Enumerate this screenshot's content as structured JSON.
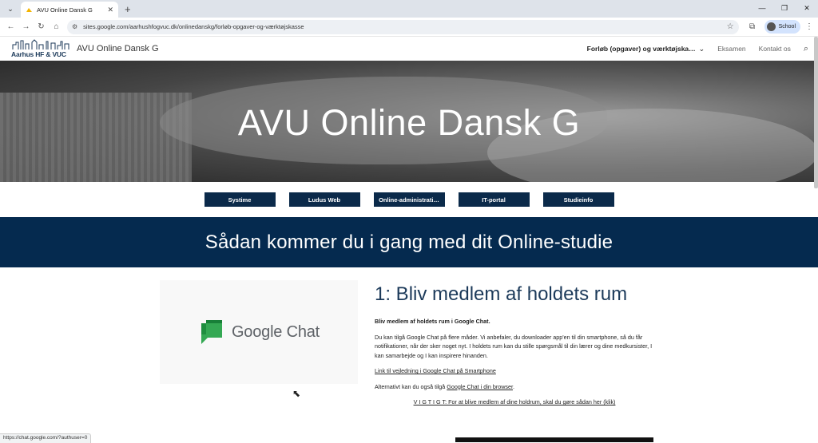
{
  "browser": {
    "tab_title": "AVU Online Dansk G",
    "tab_close": "✕",
    "new_tab": "+",
    "url": "sites.google.com/aarhushfogvuc.dk/onlinedanskg/forløb-opgaver-og-værktøjskasse",
    "profile_label": "School",
    "status_url": "https://chat.google.com/?authuser=0"
  },
  "site": {
    "logo_text": "Aarhus HF & VUC",
    "name": "AVU Online Dansk G",
    "nav": {
      "active": "Forløb (opgaver) og værktøjska…",
      "items": [
        "Eksamen",
        "Kontakt os"
      ]
    }
  },
  "hero": {
    "title": "AVU Online Dansk G"
  },
  "buttons": [
    "Systime",
    "Ludus Web",
    "Online-administrati…",
    "IT-portal",
    "Studieinfo"
  ],
  "banner": {
    "title": "Sådan kommer du i gang med dit Online-studie"
  },
  "section": {
    "card_label": "Google Chat",
    "heading": "1: Bliv medlem af holdets rum",
    "intro_bold": "Bliv medlem af holdets rum i Google Chat.",
    "paragraph": "Du kan tilgå Google Chat på flere måder. Vi anbefaler, du downloader app'en til din smartphone, så du får notifikationer, når der sker noget nyt. I holdets rum kan du stille spørgsmål til din lærer og dine medkursister, I kan samarbejde og I kan inspirere hinanden.",
    "link1": "Link til vejledning i Google Chat på Smartphone",
    "alt_prefix": "Alternativt kan du også tilgå ",
    "alt_link": "Google Chat i din browser",
    "alt_suffix": ".",
    "important_link": "V I G T I G T: For at blive medlem af dine holdrum, skal du gøre sådan her (klik)"
  },
  "colors": {
    "navy": "#052a4f",
    "button": "#0b2a4a",
    "gchat_green": "#34a853"
  }
}
